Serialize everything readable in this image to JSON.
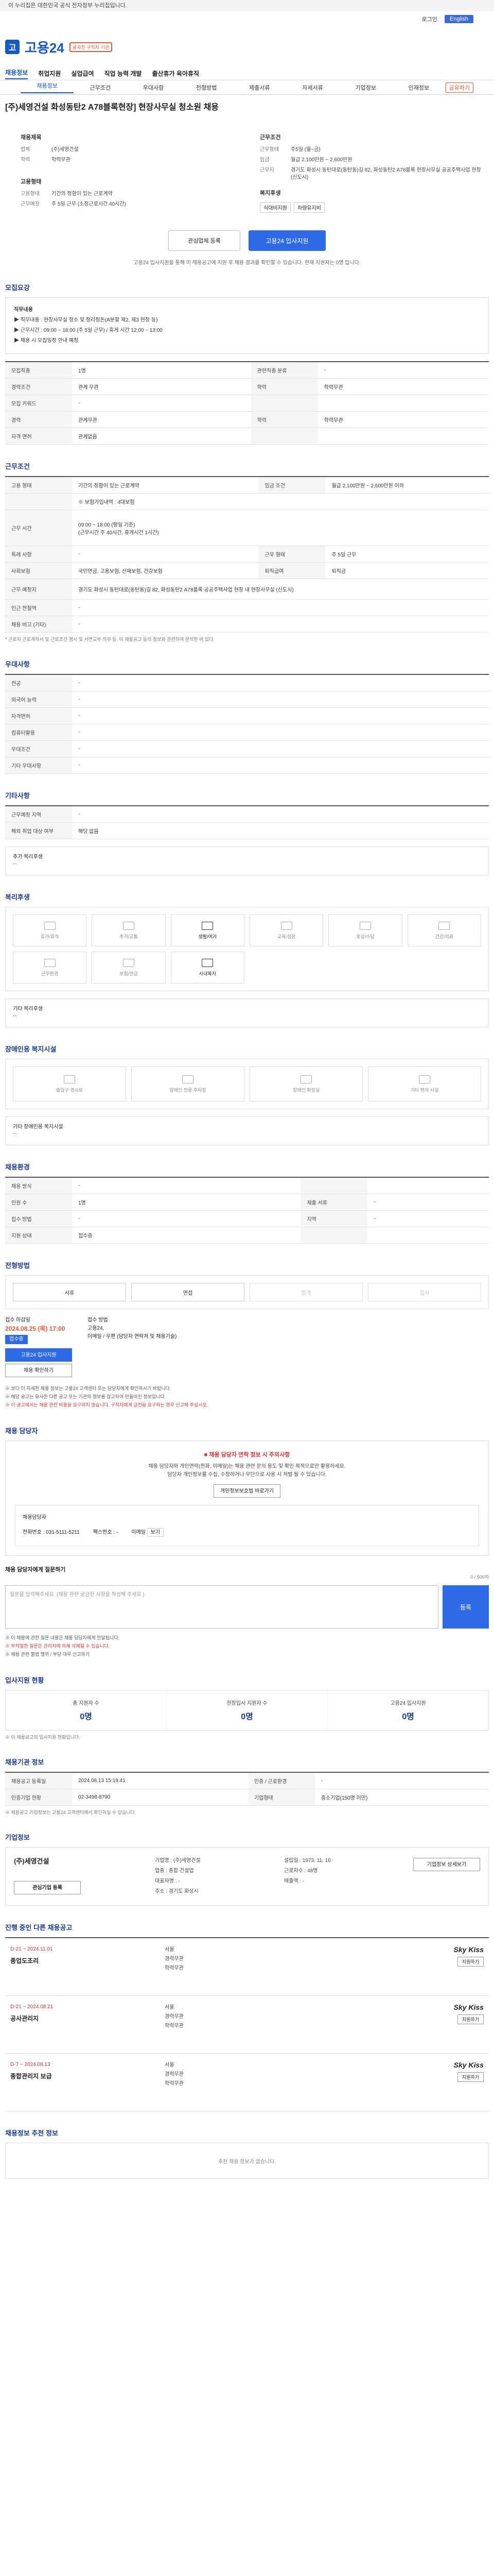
{
  "gov_bar": "이 누리집은 대한민국 공식 전자정부 누리집입니다.",
  "util": {
    "lang": "English",
    "login": "로그인",
    "join": "회원가입"
  },
  "logo": {
    "mark": "고",
    "title": "고용24",
    "badge": "굴곡진 구직자 기관"
  },
  "gnb": [
    "채용정보",
    "취업지원",
    "실업급여",
    "직업 능력 개발",
    "출산휴가 육아휴직"
  ],
  "tabs": [
    "채용정보",
    "근무조건",
    "우대사항",
    "전형방법",
    "제출서류",
    "자세서류",
    "기업정보",
    "인재정보"
  ],
  "share": "공유하기",
  "job": {
    "company": "(주)세영건설",
    "title": "[주)세영건설 화성동탄2 A78블록현장] 현장사무실 청소원 채용",
    "left_title": "채용제목",
    "left_rows": [
      {
        "k": "업체",
        "v": "(주)세영건설"
      },
      {
        "k": "학력",
        "v": "학력무관"
      }
    ],
    "right_title": "근무조건",
    "right_rows": [
      {
        "k": "근무형태",
        "v": "주5일 (월~금)"
      },
      {
        "k": "임금",
        "v": "월급 2,100만원 ~ 2,600만원"
      },
      {
        "k": "근무지",
        "v": "경기도 화성시 동탄대로(동탄동)길 82, 화성동탄2 A78블록 현장사무실 공공주택사업 현장 (신도시)"
      }
    ],
    "emp_title": "고용형태",
    "emp_rows": [
      {
        "k": "고용형태",
        "v": "기간의 정함이 있는 근로계약"
      },
      {
        "k": "근무예정",
        "v": "주 5일 근무 (소정근로시간 40시간)"
      }
    ],
    "pref_title": "복지후생",
    "chips": [
      "식대비지원",
      "차량유지비"
    ]
  },
  "apply": {
    "ghost": "관심업체 등록",
    "main": "고용24 입사지원"
  },
  "apply_note": "고용24 입사지원을 통해 이 채용공고에 지원 후 채용 결과를 확인할 수 있습니다. 현재 지원자는 0명 입니다.",
  "sec_jobdesc": "모집요강",
  "jobdesc": {
    "head": "직무내용",
    "lines": [
      "▶ 직무내용 : 현장사무실 청소 및 정리정돈(A분할 제2, 제3 현장 등)",
      "▶ 근무시간 : 09:00 ~ 18:00 (주 5일 근무) / 휴게 시간 12:00 ~ 13:00",
      "▶ 채용 시 모집일정 안내 예정"
    ]
  },
  "job_table": [
    [
      "모집직종",
      "1명",
      "관련직종 분류",
      "-"
    ],
    [
      "경력조건",
      "관계 무관",
      "학력",
      "학력무관"
    ],
    [
      "모집 키워드",
      "-",
      "",
      ""
    ],
    [
      "경력",
      "관계무관",
      "학력",
      "학력무관"
    ],
    [
      "자격 면허",
      "관계없음",
      "",
      ""
    ]
  ],
  "sec_cond": "근무조건",
  "cond": {
    "type_k": "고용 형태",
    "type_v": "기간의 정함이 있는 근로계약",
    "term_k": "임금 조건",
    "term_v": "월급 2,100만원 ~ 2,600만원 이하",
    "memo": "※ 보험가입내역 : 4대보험",
    "time_k": "근무 시간",
    "time_v": "09:00 ~ 18:00 (평일 기준)",
    "time2": "(근무시간 주 40시간, 휴게시간 1시간)",
    "dept_k": "특례 사항",
    "dept_v": "-",
    "meal_k": "근무 형태",
    "meal_v": "주 5일 근무",
    "ins_k": "사회보험",
    "ins_v": "국민연금, 고용보험, 산재보험, 건강보험",
    "welfare_k": "퇴직급여",
    "welfare_v": "퇴직금",
    "place_k": "근무 예정지",
    "place_v": "경기도 화성시 동탄대로(동탄동)길 82, 화성동탄2 A78블록 공공주택사업 현장 내 현장사무실 (신도시)",
    "near_k": "인근 전철역",
    "near_v": "-",
    "etc_k": "채용 비고 (기타)",
    "etc_v": "-"
  },
  "cond_note": "* 근로자 근로계약서 및 근로조건 명시 및 서면교부 의무 등. 이 채용공고 등의 정보와 관련하여 문의한 바 있다.",
  "sec_pref": "우대사항",
  "pref_table": [
    [
      "전공",
      "-"
    ],
    [
      "외국어 능력",
      "-"
    ],
    [
      "자격면허",
      "-"
    ],
    [
      "컴퓨터활용",
      "-"
    ],
    [
      "우대조건",
      "-"
    ],
    [
      "기타 우대사항",
      "-"
    ]
  ],
  "sec_other": "기타사항",
  "other_table": [
    [
      "근무예정 지역",
      "-"
    ],
    [
      "해외 취업 대상 여부",
      "해당 없음"
    ]
  ],
  "other_extra_label": "추가 복리후생",
  "other_extra": "...",
  "sec_welfare": "복리후생",
  "welfare_icons": [
    {
      "label": "휴가/휴직",
      "on": false
    },
    {
      "label": "주거/교통",
      "on": false
    },
    {
      "label": "생활/여가",
      "on": true
    },
    {
      "label": "교육/성장",
      "on": false
    },
    {
      "label": "포상/수당",
      "on": false
    },
    {
      "label": "건강/의료",
      "on": false
    },
    {
      "label": "근무환경",
      "on": false
    },
    {
      "label": "보험/연금",
      "on": false
    },
    {
      "label": "사내복지",
      "on": true
    }
  ],
  "welfare_sub_label": "기타 복리후생",
  "welfare_sub": "...",
  "sec_disabled": "장애인용 복지시설",
  "disabled_icons": [
    "출입구 경사로",
    "장애인 전용 주차장",
    "장애인 화장실",
    "기타 편의 시설"
  ],
  "disabled_sub_label": "기타 장애인용 복지시설",
  "disabled_sub": "...",
  "sec_place": "채용환경",
  "place_table": [
    [
      "채용 방식",
      "-",
      "",
      ""
    ],
    [
      "인원 수",
      "1명",
      "제출 서류",
      "-"
    ],
    [
      "접수 방법",
      "-",
      "지역",
      "-"
    ],
    [
      "지원 상태",
      "접수중",
      "",
      ""
    ]
  ],
  "sec_steps": "전형방법",
  "steps": [
    {
      "label": "서류",
      "on": true
    },
    {
      "label": "면접",
      "on": true
    },
    {
      "label": "합격",
      "on": false
    },
    {
      "label": "입사",
      "on": false
    }
  ],
  "deadline": {
    "title": "접수 마감일",
    "date": "2024.08.25 (목) 17:00",
    "pill": "접수중",
    "btn1": "고용24 입사지원",
    "btn2": "채용 확인하기"
  },
  "method": {
    "title": "접수 방법",
    "lines": [
      "고용24,",
      "이메일 / 우편 (담당자 연락처 및 채용기술)"
    ]
  },
  "steps_notes": [
    {
      "t": "※ 보다 더 자세한 채용 정보는 고용24 고객센터 또는 담당자에게 확인하시기 바랍니다.",
      "red": false
    },
    {
      "t": "※ 해당 공고는 유사한 다른 공고 또는 기관의 정보를 참고하여 만들어진 정보입니다.",
      "red": false
    },
    {
      "t": "※ 이 공고에서는 채용 관련 비용을 요구하지 않습니다. 구직자에게 금전을 요구하는 경우 신고해 주십시오.",
      "red": true
    }
  ],
  "sec_contact": "채용 담당자",
  "contact": {
    "warn": "■ 채용 담당자 연락 정보 시 주의사항",
    "info1": "채용 담당자와 개인연락(전화, 이메일)는 채용 관련 문의 용도 및 확인 목적으로만 활용하세요.",
    "info2": "담당자 개인정보를 수집, 수정하거나 무단으로 사용 시 처벌 될 수 있습니다.",
    "link": "개인정보보호법 바로가기",
    "inner_label": "채용담당자",
    "tel_k": "전화번호",
    "tel_v": "031-5111-5211",
    "fax_k": "팩스번호",
    "fax_v": "-",
    "mail_k": "이메일",
    "mail_v": "보기",
    "qa_title": "채용 담당자에게 질문하기",
    "qa_placeholder": "질문을 입력해주세요. (채용 관련 궁금한 사항을 작성해 주세요.)",
    "qa_btn": "등록",
    "qa_count": "0 / 500자"
  },
  "contact_notes": [
    {
      "t": "※ 이 채용에 관한 질문 내용은 채용 담당자에게 전달됩니다.",
      "red": false
    },
    {
      "t": "※ 부적절한 질문은 관리자에 의해 삭제될 수 있습니다.",
      "red": true
    },
    {
      "t": "※ 채용 관련 불법 행위 / 부당 대우 신고하기",
      "red": false
    }
  ],
  "sec_stats": "입사지원 현황",
  "stats": [
    {
      "k": "총 지원자 수",
      "v": "0명"
    },
    {
      "k": "현장입사 지원자 수",
      "v": "0명"
    },
    {
      "k": "고용24 입사지원",
      "v": "0명"
    }
  ],
  "stats_note": "※ 이 채용공고의 입사지원 현황입니다.",
  "sec_notice": "채용기관 정보",
  "notice_table": [
    [
      "채용공고 등록일",
      "2024.08.13 15:19:41",
      "인증 / 근로환경",
      "-"
    ],
    [
      "인증기업 현황",
      "02-3498-8790",
      "기업형태",
      "중소기업(150명 미만)"
    ]
  ],
  "notice_note": "※ 채용공고 기업정보는 고용24 고객센터에서 확인하실 수 있습니다.",
  "sec_company": "기업정보",
  "company": {
    "name": "(주)세영건설",
    "rows": [
      "기업명 : (주)세영건설",
      "업종 : 종합 건설업",
      "대표자명 : -",
      "주소 : 경기도 화성시"
    ],
    "right": [
      "설립일 : 1973. 11. 16",
      "근로자수 : 48명",
      "매출액 : -"
    ],
    "btn": "기업정보 상세보기",
    "btn2": "관심기업 등록"
  },
  "sec_similar": "진행 중인 다른 채용공고",
  "similar": [
    {
      "date": "D-21 ~ 2024.11.01",
      "title": "종업도조리",
      "mid": [
        "서울",
        "경력무관",
        "학력무관"
      ],
      "logo": "Sky Kiss",
      "btn": "지원하기"
    },
    {
      "date": "D-21 ~ 2024.08.21",
      "title": "공사관리지",
      "mid": [
        "서울",
        "경력무관",
        "학력무관"
      ],
      "logo": "Sky Kiss",
      "btn": "지원하기"
    },
    {
      "date": "D-7 ~ 2024.08.13",
      "title": "종합관리지 보급",
      "mid": [
        "서울",
        "경력무관",
        "학력무관"
      ],
      "logo": "Sky Kiss",
      "btn": "지원하기"
    }
  ],
  "sec_rec": "채용정보 추천 정보",
  "rec_empty": "추천 채용 정보가 없습니다."
}
